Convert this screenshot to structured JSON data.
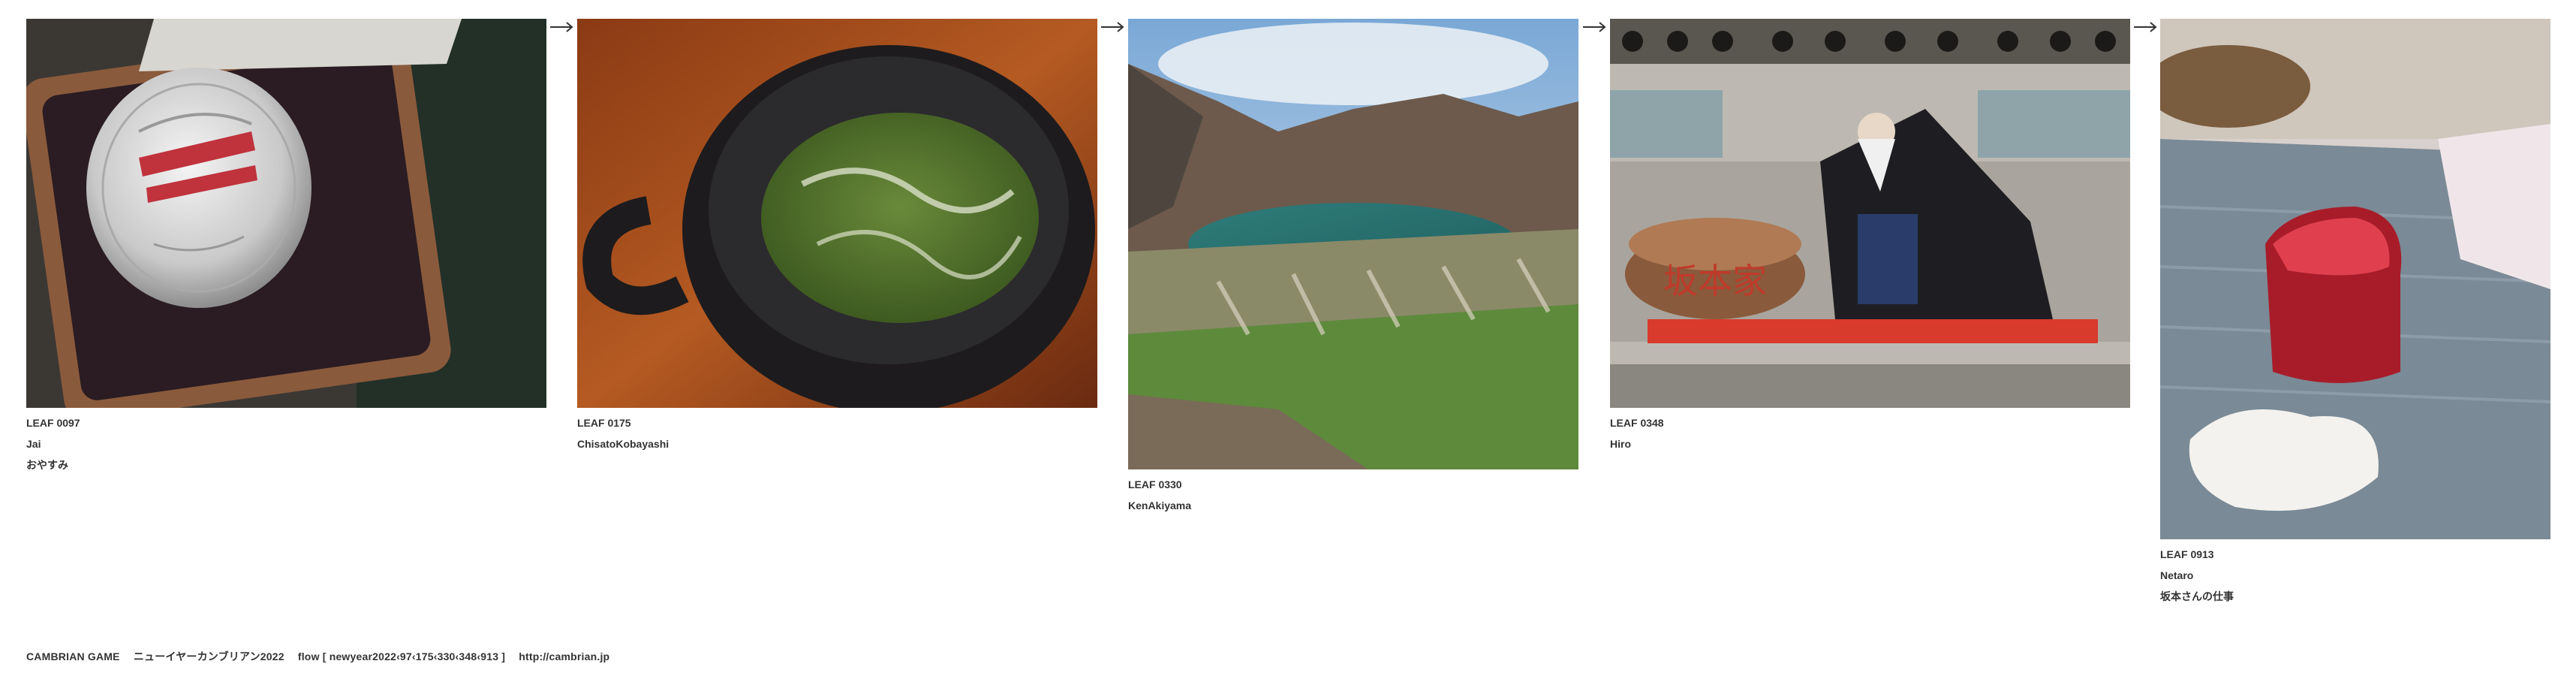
{
  "leaves": [
    {
      "id": "LEAF 0097",
      "author": "Jai",
      "comment": "おやすみ",
      "subject": "silver commemorative coin in a case"
    },
    {
      "id": "LEAF 0175",
      "author": "ChisatoKobayashi",
      "comment": "",
      "subject": "bowl of green matcha"
    },
    {
      "id": "LEAF 0330",
      "author": "KenAkiyama",
      "comment": "",
      "subject": "crater lake in the mountains"
    },
    {
      "id": "LEAF 0348",
      "author": "Hiro",
      "comment": "",
      "subject": "storefront sign with a cutting figure"
    },
    {
      "id": "LEAF 0913",
      "author": "Netaro",
      "comment": "坂本さんの仕事",
      "subject": "slab of red tuna on a cloth"
    }
  ],
  "sign": {
    "text": "坂本家"
  },
  "arrow_icon": "right-arrow-icon",
  "footer": {
    "brand": "CAMBRIAN GAME",
    "title": "ニューイヤーカンブリアン2022",
    "flow": "flow [ newyear2022‹97‹175‹330‹348‹913 ]",
    "url": "http://cambrian.jp"
  }
}
